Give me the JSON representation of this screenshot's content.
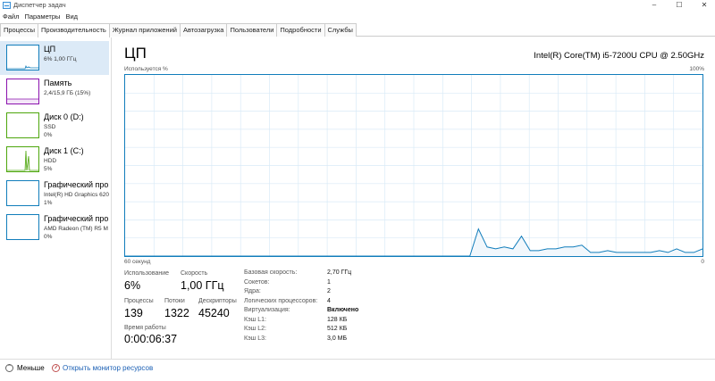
{
  "window": {
    "title": "Диспетчер задач",
    "minimize": "–",
    "maximize": "☐",
    "close": "✕"
  },
  "menu": [
    "Файл",
    "Параметры",
    "Вид"
  ],
  "tabs": [
    "Процессы",
    "Производительность",
    "Журнал приложений",
    "Автозагрузка",
    "Пользователи",
    "Подробности",
    "Службы"
  ],
  "active_tab": "Производительность",
  "sidebar": [
    {
      "title": "ЦП",
      "sub1": "6% 1,00 ГГц",
      "sub2": "",
      "color": "#117dbb"
    },
    {
      "title": "Память",
      "sub1": "2,4/15,9 ГБ (15%)",
      "sub2": "",
      "color": "#8b12ae"
    },
    {
      "title": "Диск 0 (D:)",
      "sub1": "SSD",
      "sub2": "0%",
      "color": "#4da60c"
    },
    {
      "title": "Диск 1 (C:)",
      "sub1": "HDD",
      "sub2": "5%",
      "color": "#4da60c"
    },
    {
      "title": "Графический про",
      "sub1": "Intel(R) HD Graphics 620",
      "sub2": "1%",
      "color": "#117dbb"
    },
    {
      "title": "Графический про",
      "sub1": "AMD Radeon (TM) R5 M",
      "sub2": "0%",
      "color": "#117dbb"
    }
  ],
  "main": {
    "title": "ЦП",
    "cpu_model": "Intel(R) Core(TM) i5-7200U CPU @ 2.50GHz",
    "util_label": "Используется %",
    "max_label": "100%",
    "time_label": "60 секунд",
    "zero_label": "0",
    "stats": {
      "utilization_label": "Использование",
      "utilization": "6%",
      "speed_label": "Скорость",
      "speed": "1,00 ГГц",
      "processes_label": "Процессы",
      "processes": "139",
      "threads_label": "Потоки",
      "threads": "1322",
      "handles_label": "Дескрипторы",
      "handles": "45240",
      "uptime_label": "Время работы",
      "uptime": "0:00:06:37"
    },
    "info": [
      {
        "key": "Базовая скорость:",
        "value": "2,70 ГГц"
      },
      {
        "key": "Сокетов:",
        "value": "1"
      },
      {
        "key": "Ядра:",
        "value": "2"
      },
      {
        "key": "Логических процессоров:",
        "value": "4"
      },
      {
        "key": "Виртуализация:",
        "value": "Включено"
      },
      {
        "key": "Кэш L1:",
        "value": "128 КБ"
      },
      {
        "key": "Кэш L2:",
        "value": "512 КБ"
      },
      {
        "key": "Кэш L3:",
        "value": "3,0 МБ"
      }
    ],
    "cpu_history": [
      0,
      0,
      0,
      0,
      0,
      0,
      0,
      0,
      0,
      0,
      0,
      0,
      0,
      0,
      0,
      0,
      0,
      0,
      0,
      0,
      0,
      0,
      0,
      0,
      0,
      0,
      0,
      0,
      0,
      0,
      0,
      0,
      0,
      0,
      0,
      0,
      0,
      0,
      0,
      0,
      0,
      15,
      5,
      4,
      5,
      4,
      11,
      3,
      3,
      4,
      4,
      5,
      5,
      6,
      2,
      2,
      3,
      2,
      2,
      2,
      2,
      2,
      3,
      2,
      4,
      2,
      2,
      4
    ],
    "graph_color": "#117dbb"
  },
  "footer": {
    "fewer": "Меньше",
    "resource_monitor": "Открыть монитор ресурсов"
  }
}
